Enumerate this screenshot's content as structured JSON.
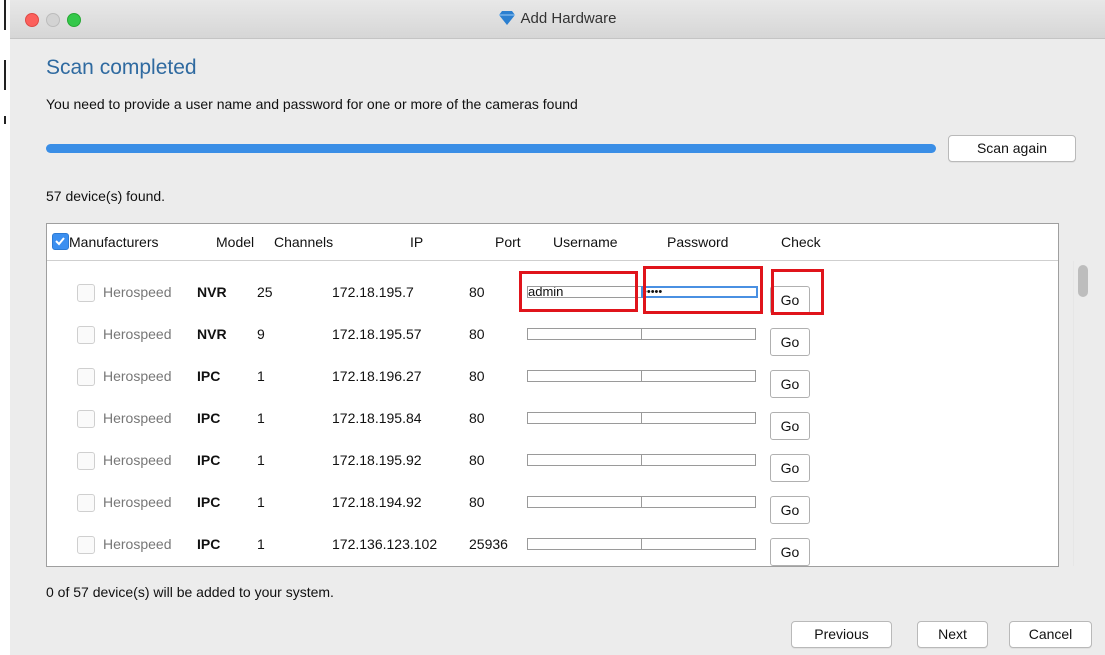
{
  "window": {
    "title": "Add Hardware"
  },
  "heading": "Scan completed",
  "subtext": "You need to provide a user name and password for one or more of the cameras found",
  "progress": {
    "percent": 100,
    "color": "#3a8ee6"
  },
  "scan_again_label": "Scan again",
  "found_text": "57 device(s) found.",
  "columns": {
    "manufacturers": "Manufacturers",
    "model": "Model",
    "channels": "Channels",
    "ip": "IP",
    "port": "Port",
    "username": "Username",
    "password": "Password",
    "check": "Check"
  },
  "rows": [
    {
      "manufacturer": "Herospeed",
      "model": "NVR",
      "channels": "25",
      "ip": "172.18.195.7",
      "port": "80",
      "username": "admin",
      "password": "•••••",
      "go": "Go"
    },
    {
      "manufacturer": "Herospeed",
      "model": "NVR",
      "channels": "9",
      "ip": "172.18.195.57",
      "port": "80",
      "username": "",
      "password": "",
      "go": "Go"
    },
    {
      "manufacturer": "Herospeed",
      "model": "IPC",
      "channels": "1",
      "ip": "172.18.196.27",
      "port": "80",
      "username": "",
      "password": "",
      "go": "Go"
    },
    {
      "manufacturer": "Herospeed",
      "model": "IPC",
      "channels": "1",
      "ip": "172.18.195.84",
      "port": "80",
      "username": "",
      "password": "",
      "go": "Go"
    },
    {
      "manufacturer": "Herospeed",
      "model": "IPC",
      "channels": "1",
      "ip": "172.18.195.92",
      "port": "80",
      "username": "",
      "password": "",
      "go": "Go"
    },
    {
      "manufacturer": "Herospeed",
      "model": "IPC",
      "channels": "1",
      "ip": "172.18.194.92",
      "port": "80",
      "username": "",
      "password": "",
      "go": "Go"
    },
    {
      "manufacturer": "Herospeed",
      "model": "IPC",
      "channels": "1",
      "ip": "172.136.123.102",
      "port": "25936",
      "username": "",
      "password": "",
      "go": "Go"
    }
  ],
  "added_text": "0 of 57 device(s) will be added to your system.",
  "buttons": {
    "previous": "Previous",
    "next": "Next",
    "cancel": "Cancel"
  },
  "colors": {
    "accent": "#3a8ee6",
    "heading": "#2f6aa0",
    "highlight": "#e0141b"
  }
}
